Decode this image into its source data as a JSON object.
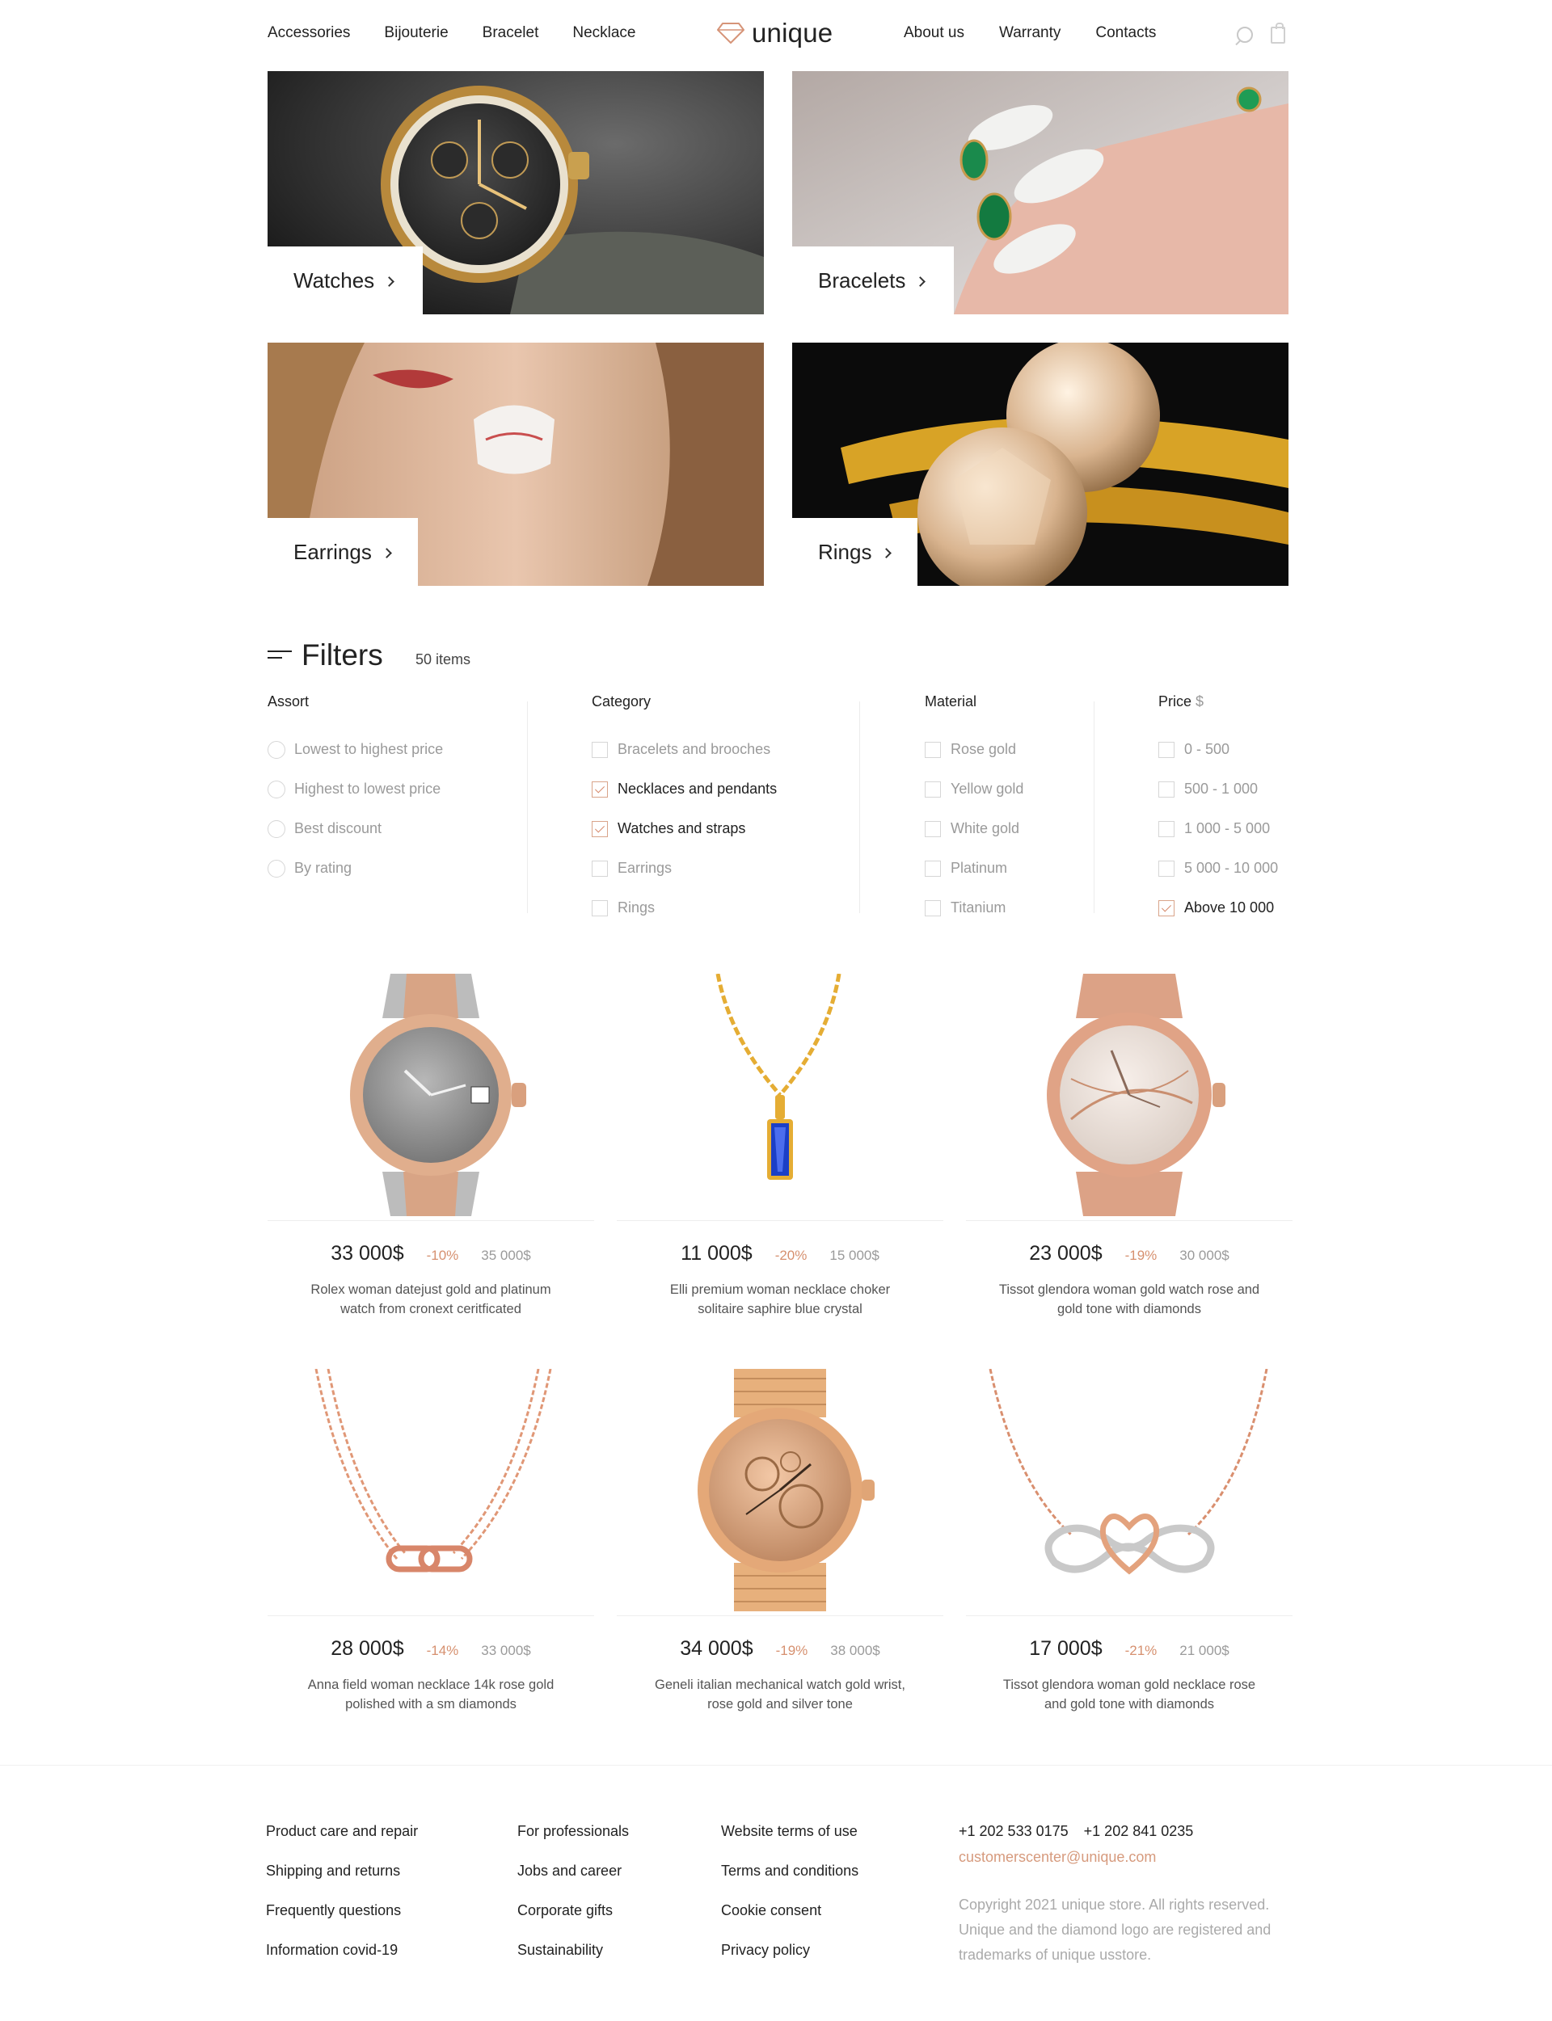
{
  "header": {
    "nav_left": [
      "Accessories",
      "Bijouterie",
      "Bracelet",
      "Necklace"
    ],
    "logo_text": "unique",
    "nav_right": [
      "About us",
      "Warranty",
      "Contacts"
    ],
    "icons": [
      "search-icon",
      "cart-icon"
    ]
  },
  "categories": [
    {
      "label": "Watches"
    },
    {
      "label": "Bracelets"
    },
    {
      "label": "Earrings"
    },
    {
      "label": "Rings"
    }
  ],
  "filters": {
    "title": "Filters",
    "count": "50 items",
    "assort": {
      "title": "Assort",
      "options": [
        {
          "label": "Lowest to highest price",
          "selected": false
        },
        {
          "label": "Highest to lowest price",
          "selected": false
        },
        {
          "label": "Best discount",
          "selected": false
        },
        {
          "label": "By rating",
          "selected": false
        }
      ]
    },
    "category": {
      "title": "Category",
      "options": [
        {
          "label": "Bracelets and brooches",
          "checked": false
        },
        {
          "label": "Necklaces and pendants",
          "checked": true
        },
        {
          "label": "Watches and straps",
          "checked": true
        },
        {
          "label": "Earrings",
          "checked": false
        },
        {
          "label": "Rings",
          "checked": false
        }
      ]
    },
    "material": {
      "title": "Material",
      "options": [
        {
          "label": "Rose gold",
          "checked": false
        },
        {
          "label": "Yellow gold",
          "checked": false
        },
        {
          "label": "White gold",
          "checked": false
        },
        {
          "label": "Platinum",
          "checked": false
        },
        {
          "label": "Titanium",
          "checked": false
        }
      ]
    },
    "price": {
      "title": "Price",
      "currency": "$",
      "options": [
        {
          "label": "0 - 500",
          "checked": false
        },
        {
          "label": "500 - 1 000",
          "checked": false
        },
        {
          "label": "1 000 - 5 000",
          "checked": false
        },
        {
          "label": "5 000 - 10 000",
          "checked": false
        },
        {
          "label": "Above 10 000",
          "checked": true
        }
      ]
    }
  },
  "products": [
    {
      "price": "33 000$",
      "discount": "-10%",
      "old_price": "35 000$",
      "desc": "Rolex woman datejust gold and platinum watch from cronext ceritficated"
    },
    {
      "price": "11 000$",
      "discount": "-20%",
      "old_price": "15 000$",
      "desc": "Elli premium woman necklace choker solitaire saphire blue crystal"
    },
    {
      "price": "23 000$",
      "discount": "-19%",
      "old_price": "30 000$",
      "desc": "Tissot glendora woman gold watch rose and gold tone with diamonds"
    },
    {
      "price": "28 000$",
      "discount": "-14%",
      "old_price": "33 000$",
      "desc": "Anna field woman necklace 14k rose gold polished with a sm diamonds"
    },
    {
      "price": "34 000$",
      "discount": "-19%",
      "old_price": "38 000$",
      "desc": "Geneli italian mechanical watch gold wrist, rose gold and silver tone"
    },
    {
      "price": "17 000$",
      "discount": "-21%",
      "old_price": "21 000$",
      "desc": "Tissot glendora woman gold necklace rose and gold tone with diamonds"
    }
  ],
  "footer": {
    "col1": [
      "Product care and repair",
      "Shipping and returns",
      "Frequently questions",
      "Information covid-19"
    ],
    "col2": [
      "For professionals",
      "Jobs and career",
      "Corporate gifts",
      "Sustainability"
    ],
    "col3": [
      "Website terms of use",
      "Terms and conditions",
      "Cookie consent",
      "Privacy policy"
    ],
    "phone1": "+1 202 533 0175",
    "phone2": "+1 202 841 0235",
    "email": "customerscenter@unique.com",
    "copyright": "Copyright 2021 unique store. All rights reserved. Unique and the diamond logo are registered and trademarks of unique usstore."
  },
  "colors": {
    "accent": "#d6906f",
    "text": "#222222",
    "muted": "#9a9a9a"
  }
}
